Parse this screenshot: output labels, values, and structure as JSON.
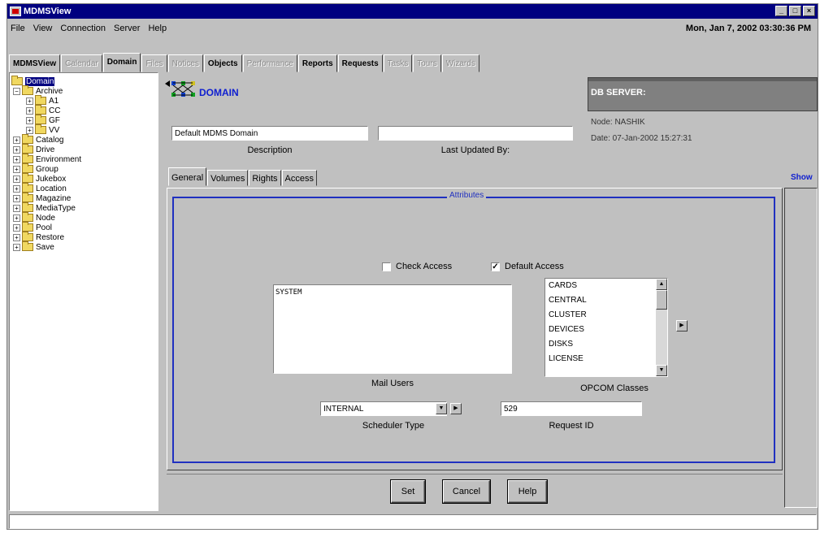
{
  "window": {
    "title": "MDMSView",
    "minimize": "_",
    "maximize": "□",
    "close": "×"
  },
  "menu": {
    "items": [
      "File",
      "View",
      "Connection",
      "Server",
      "Help"
    ],
    "datetime": "Mon, Jan 7, 2002 03:30:36 PM"
  },
  "main_tabs": [
    {
      "label": "MDMSView",
      "disabled": false
    },
    {
      "label": "Calendar",
      "disabled": true
    },
    {
      "label": "Domain",
      "disabled": false,
      "active": true
    },
    {
      "label": "Files",
      "disabled": true
    },
    {
      "label": "Notices",
      "disabled": true
    },
    {
      "label": "Objects",
      "disabled": false
    },
    {
      "label": "Performance",
      "disabled": true
    },
    {
      "label": "Reports",
      "disabled": false
    },
    {
      "label": "Requests",
      "disabled": false
    },
    {
      "label": "Tasks",
      "disabled": true
    },
    {
      "label": "Tours",
      "disabled": true
    },
    {
      "label": "Wizards",
      "disabled": true
    }
  ],
  "tree": {
    "root": "Domain",
    "archive": "Archive",
    "archive_children": [
      "A1",
      "CC",
      "GF",
      "VV"
    ],
    "others": [
      "Catalog",
      "Drive",
      "Environment",
      "Group",
      "Jukebox",
      "Location",
      "Magazine",
      "MediaType",
      "Node",
      "Pool",
      "Restore",
      "Save"
    ]
  },
  "header": {
    "title": "DOMAIN",
    "description_value": "Default MDMS Domain",
    "description_label": "Description",
    "last_updated_value": "",
    "last_updated_label": "Last Updated By:",
    "db_server_label": "DB SERVER:",
    "node": "Node: NASHIK",
    "date": "Date: 07-Jan-2002 15:27:31",
    "show": "Show"
  },
  "sub_tabs": [
    "General",
    "Volumes",
    "Rights",
    "Access"
  ],
  "attributes": {
    "legend": "Attributes",
    "check_access_label": "Check Access",
    "check_access_checked": false,
    "default_access_label": "Default Access",
    "default_access_checked": true,
    "mail_users_value": "SYSTEM",
    "mail_users_label": "Mail Users",
    "opcom_classes": [
      "CARDS",
      "CENTRAL",
      "CLUSTER",
      "DEVICES",
      "DISKS",
      "LICENSE"
    ],
    "opcom_label": "OPCOM Classes",
    "scheduler_type_value": "INTERNAL",
    "scheduler_type_label": "Scheduler Type",
    "request_id_value": "529",
    "request_id_label": "Request ID"
  },
  "buttons": {
    "set": "Set",
    "cancel": "Cancel",
    "help": "Help"
  },
  "status_text": ""
}
